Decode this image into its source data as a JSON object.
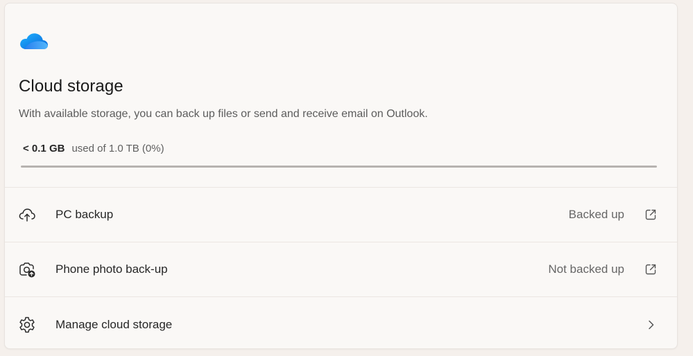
{
  "header": {
    "icon": "onedrive-cloud-icon",
    "title": "Cloud storage",
    "description": "With available storage, you can back up files or send and receive email on Outlook."
  },
  "usage": {
    "used": "< 0.1 GB",
    "of_text": "used of 1.0 TB (0%)",
    "percent": 0
  },
  "rows": [
    {
      "label": "PC backup",
      "status": "Backed up",
      "icon": "cloud-upload-icon",
      "trailing_icon": "open-external-icon"
    },
    {
      "label": "Phone photo back-up",
      "status": "Not backed up",
      "icon": "camera-sync-icon",
      "trailing_icon": "open-external-icon"
    },
    {
      "label": "Manage cloud storage",
      "status": "",
      "icon": "gear-icon",
      "trailing_icon": "chevron-right-icon"
    }
  ],
  "colors": {
    "accent": "#0067c0",
    "bar_track": "#b7b3b0",
    "card_bg": "#faf8f6"
  }
}
